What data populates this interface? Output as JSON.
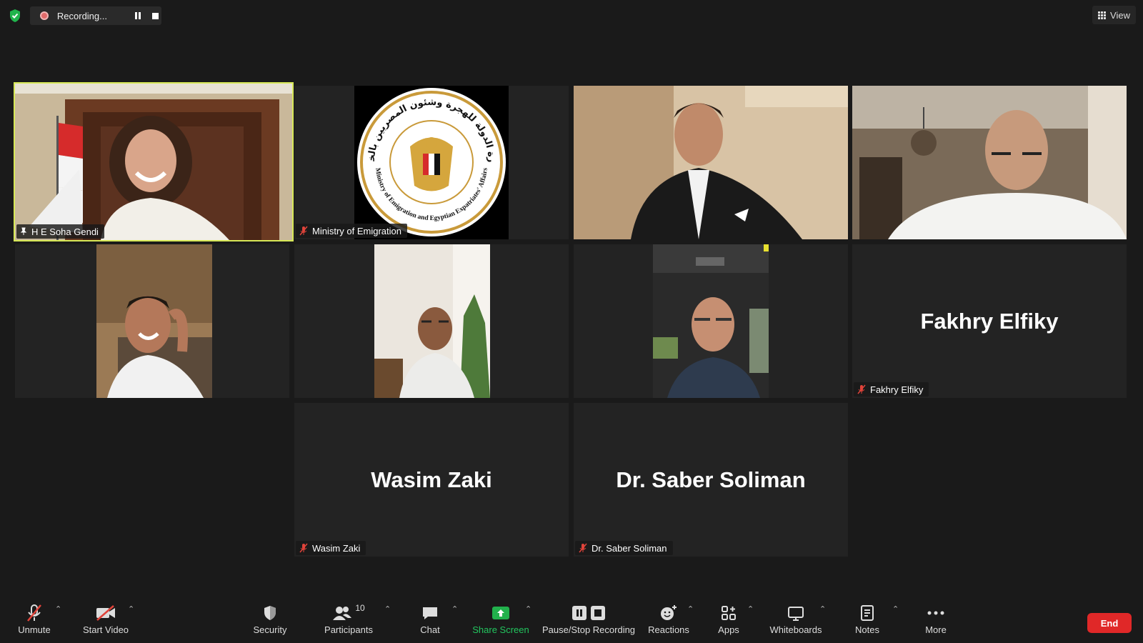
{
  "top_bar": {
    "recording_label": "Recording...",
    "view_label": "View"
  },
  "tiles": [
    {
      "name": "H E Soha Gendi",
      "big_name": "",
      "muted": false,
      "pinned": true,
      "active": true
    },
    {
      "name": "Ministry of Emigration",
      "big_name": "",
      "muted": true,
      "pinned": false,
      "active": false
    },
    {
      "name": "",
      "big_name": "",
      "muted": false,
      "pinned": false,
      "active": false
    },
    {
      "name": "",
      "big_name": "",
      "muted": false,
      "pinned": false,
      "active": false
    },
    {
      "name": "",
      "big_name": "",
      "muted": false,
      "pinned": false,
      "active": false
    },
    {
      "name": "",
      "big_name": "",
      "muted": false,
      "pinned": false,
      "active": false
    },
    {
      "name": "",
      "big_name": "",
      "muted": false,
      "pinned": false,
      "active": false
    },
    {
      "name": "Fakhry Elfiky",
      "big_name": "Fakhry Elfiky",
      "muted": true,
      "pinned": false,
      "active": false
    },
    {
      "name": "Wasim Zaki",
      "big_name": "Wasim Zaki",
      "muted": true,
      "pinned": false,
      "active": false
    },
    {
      "name": "Dr. Saber Soliman",
      "big_name": "Dr. Saber Soliman",
      "muted": true,
      "pinned": false,
      "active": false
    }
  ],
  "logo": {
    "arabic_text": "وزارة الدولة للهجرة وشئون المصريين بالخارج",
    "english_text": "Ministry of Emigration and Egyptian Expatriates' Affairs"
  },
  "toolbar": {
    "unmute": "Unmute",
    "start_video": "Start Video",
    "security": "Security",
    "participants": "Participants",
    "participants_count": "10",
    "chat": "Chat",
    "share_screen": "Share Screen",
    "pause_stop_recording": "Pause/Stop Recording",
    "reactions": "Reactions",
    "apps": "Apps",
    "whiteboards": "Whiteboards",
    "notes": "Notes",
    "more": "More",
    "end": "End"
  },
  "colors": {
    "background": "#1a1a1a",
    "tile": "#232323",
    "active_speaker_border": "#d7e857",
    "share_green": "#22b14c",
    "end_red": "#e02828",
    "muted_red": "#e0433a"
  }
}
